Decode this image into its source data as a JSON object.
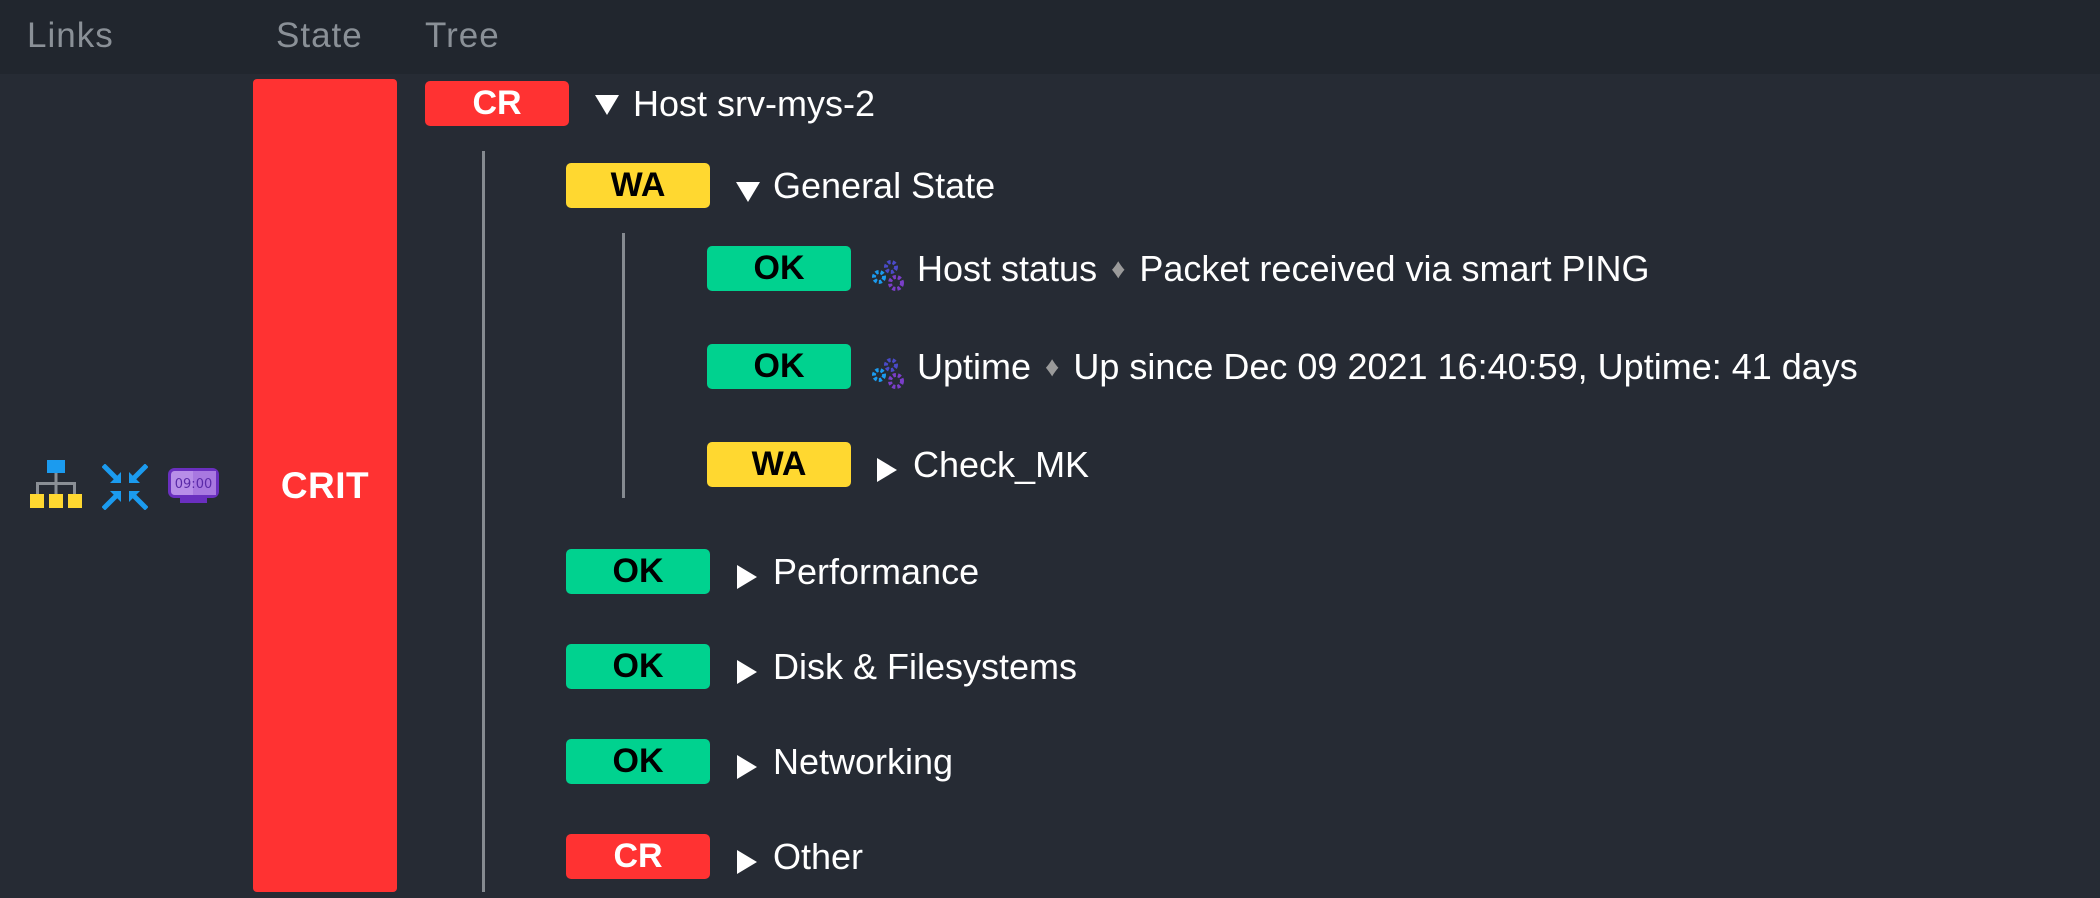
{
  "header": {
    "columns": [
      "Links",
      "State",
      "Tree"
    ]
  },
  "links": {
    "icons": [
      "bi-tree-icon",
      "collapse-icon",
      "downtime-clock-icon"
    ],
    "clock_text": "09:00"
  },
  "state": {
    "label": "CRIT",
    "color": "#ff3232"
  },
  "colors": {
    "crit": "#ff3232",
    "warn": "#ffd830",
    "ok": "#00d28f"
  },
  "tree": {
    "root": {
      "badge": "CR",
      "expander": "expanded",
      "title": "Host srv-mys-2"
    },
    "general_state": {
      "badge": "WA",
      "expander": "expanded",
      "title": "General State",
      "children": [
        {
          "badge": "OK",
          "icon": "service-gears-icon",
          "title": "Host status",
          "separator": "♦",
          "detail": "Packet received via smart PING"
        },
        {
          "badge": "OK",
          "icon": "service-gears-icon",
          "title": "Uptime",
          "separator": "♦",
          "detail": "Up since Dec 09 2021 16:40:59, Uptime: 41 days"
        },
        {
          "badge": "WA",
          "expander": "collapsed",
          "title": "Check_MK"
        }
      ]
    },
    "groups": [
      {
        "badge": "OK",
        "expander": "collapsed",
        "title": "Performance"
      },
      {
        "badge": "OK",
        "expander": "collapsed",
        "title": "Disk & Filesystems"
      },
      {
        "badge": "OK",
        "expander": "collapsed",
        "title": "Networking"
      },
      {
        "badge": "CR",
        "expander": "collapsed",
        "title": "Other"
      }
    ]
  }
}
